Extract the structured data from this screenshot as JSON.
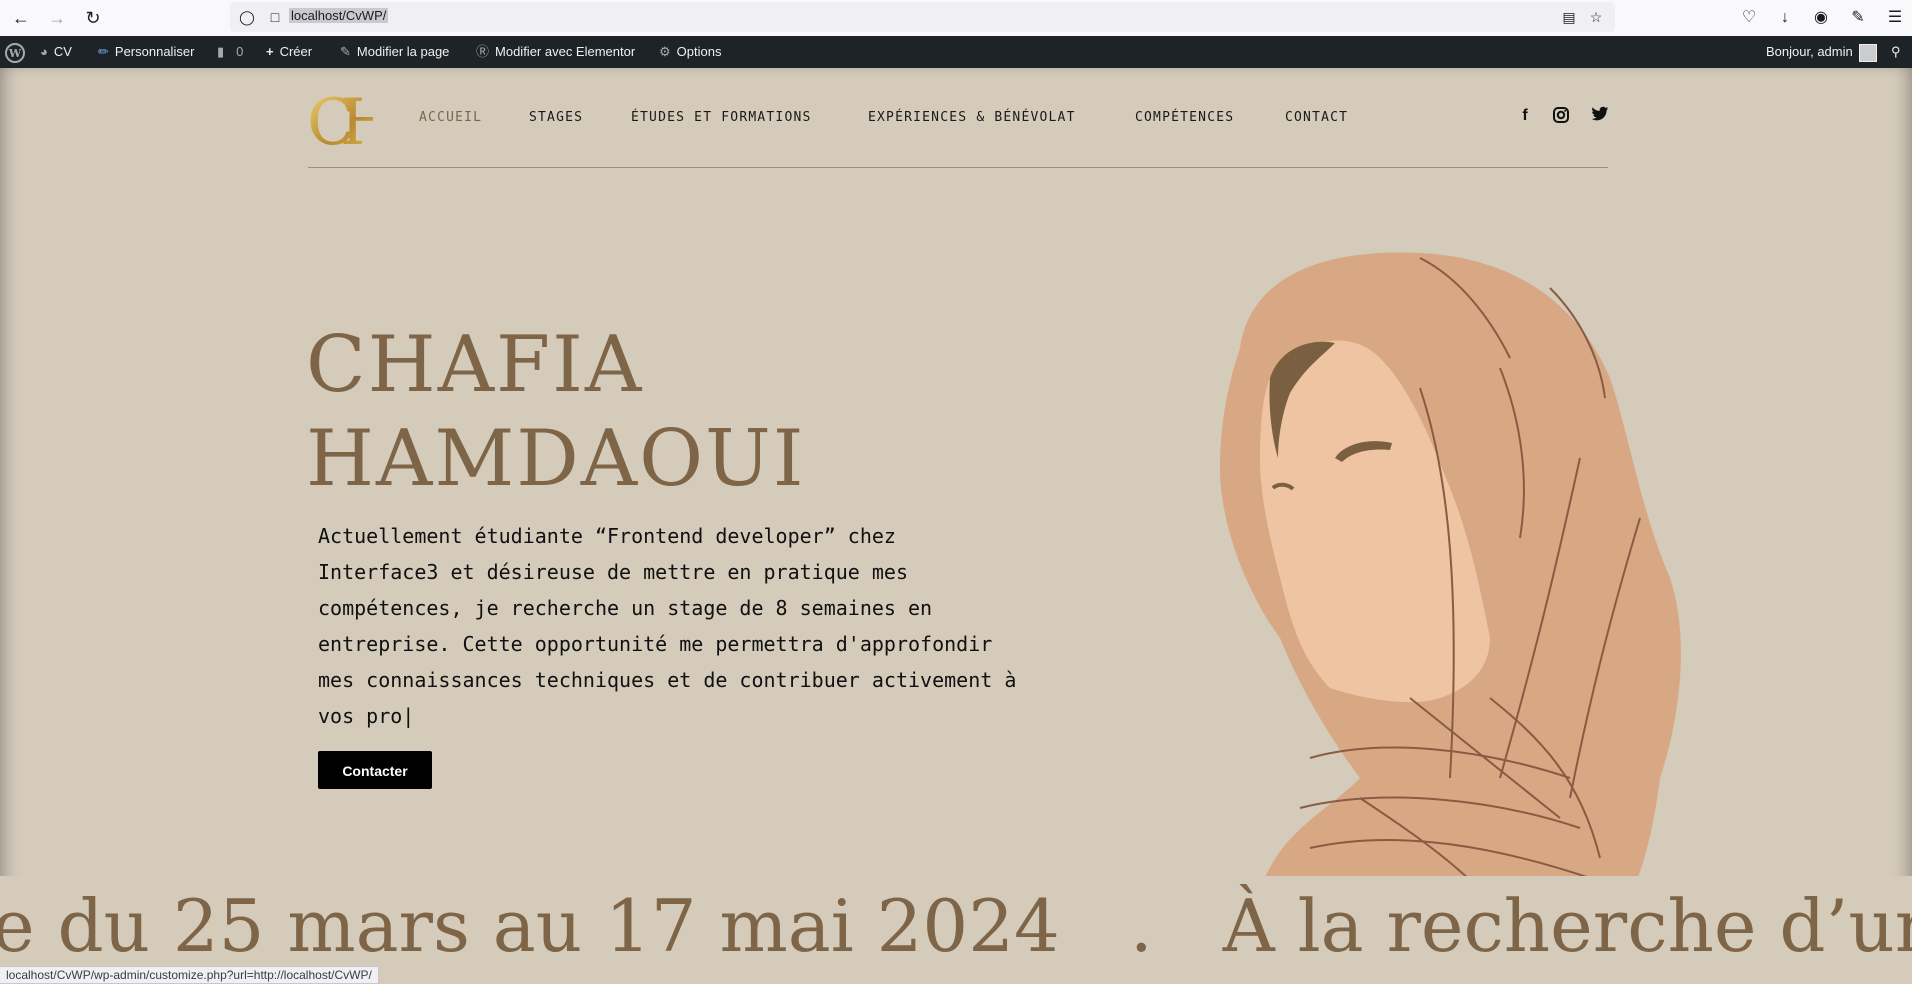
{
  "browser": {
    "url": "localhost/CvWP/",
    "back_icon": "arrow-left-icon",
    "forward_icon": "arrow-right-icon",
    "reload_icon": "reload-icon"
  },
  "adminbar": {
    "wp_logo": "wordpress-icon",
    "site_name": "CV",
    "customize": "Personnaliser",
    "comments_count": "0",
    "new": "Créer",
    "edit_page": "Modifier la page",
    "edit_elementor": "Modifier avec Elementor",
    "options": "Options",
    "greeting": "Bonjour, admin"
  },
  "site": {
    "logo_text": "CH",
    "nav": [
      {
        "label": "ACCUEIL",
        "active": true
      },
      {
        "label": "STAGES",
        "active": false
      },
      {
        "label": "ÉTUDES ET FORMATIONS",
        "active": false
      },
      {
        "label": "EXPÉRIENCES & BÉNÉVOLAT",
        "active": false
      },
      {
        "label": "COMPÉTENCES",
        "active": false
      },
      {
        "label": "CONTACT",
        "active": false
      }
    ],
    "social": [
      "facebook-icon",
      "instagram-icon",
      "twitter-icon"
    ]
  },
  "hero": {
    "name_line1": "CHAFIA",
    "name_line2": "HAMDAOUI",
    "text": "Actuellement étudiante “Frontend developer” chez Interface3 et désireuse de mettre en pratique mes compétences, je recherche un stage de 8 semaines en entreprise. Cette opportunité me permettra d'approfondir mes connaissances techniques et de contribuer activement à vos pro|",
    "cta": "Contacter"
  },
  "marquee": {
    "part1": "e du 25 mars au 17 mai 2024",
    "separator": ".",
    "part2": "À la recherche d’un st"
  },
  "status_url": "localhost/CvWP/wp-admin/customize.php?url=http://localhost/CvWP/",
  "colors": {
    "background": "#d4cbbb",
    "accent": "#7f6548",
    "adminbar": "#1d2327"
  }
}
